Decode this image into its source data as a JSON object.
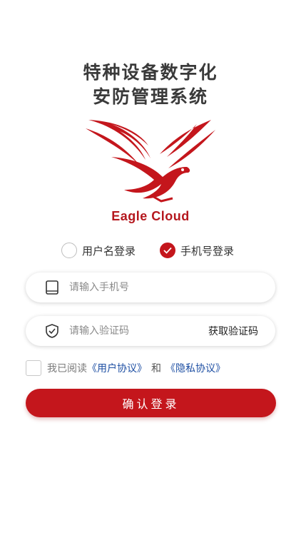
{
  "header": {
    "title_line1": "特种设备数字化",
    "title_line2": "安防管理系统"
  },
  "logo": {
    "text": "Eagle Cloud",
    "icon": "eagle-logo",
    "color": "#b5181e"
  },
  "login_modes": [
    {
      "label": "用户名登录",
      "selected": false
    },
    {
      "label": "手机号登录",
      "selected": true
    }
  ],
  "phone_field": {
    "placeholder": "请输入手机号",
    "value": "",
    "icon": "tablet-icon"
  },
  "code_field": {
    "placeholder": "请输入验证码",
    "value": "",
    "icon": "shield-check-icon",
    "get_code_label": "获取验证码"
  },
  "agreement": {
    "checked": false,
    "prefix": "我已阅读",
    "user_agreement": "《用户协议》",
    "and": "和",
    "privacy_policy": "《隐私协议》"
  },
  "submit": {
    "label": "确认登录"
  },
  "colors": {
    "accent": "#c4161c",
    "link": "#1e4fa3"
  }
}
